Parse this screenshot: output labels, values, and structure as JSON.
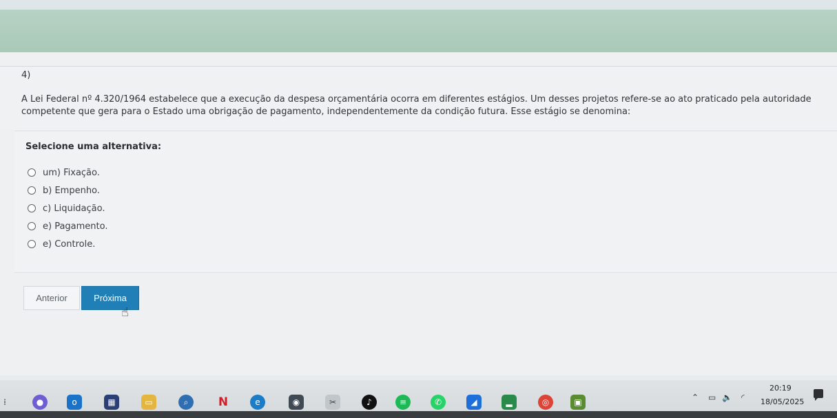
{
  "question": {
    "number": "4)",
    "text": "A Lei Federal nº 4.320/1964 estabelece que a execução da despesa orçamentária ocorra em diferentes estágios. Um desses projetos refere-se ao ato praticado pela autoridade competente que gera para o Estado uma obrigação de pagamento, independentemente da condição futura. Esse estágio se denomina:"
  },
  "select_label": "Selecione uma alternativa:",
  "options": [
    {
      "label": "um) Fixação."
    },
    {
      "label": "b) Empenho."
    },
    {
      "label": "c) Liquidação."
    },
    {
      "label": "e) Pagamento."
    },
    {
      "label": "e) Controle."
    }
  ],
  "buttons": {
    "previous": "Anterior",
    "next": "Próxima"
  },
  "taskbar": {
    "time": "20:19",
    "date": "18/05/2025",
    "icons": [
      "widgets-icon",
      "media-player-icon",
      "outlook-icon",
      "calculator-icon",
      "file-explorer-icon",
      "search-app-icon",
      "netflix-icon",
      "edge-icon",
      "camera-icon",
      "snipping-tool-icon",
      "tiktok-icon",
      "spotify-icon",
      "whatsapp-icon",
      "photos-icon",
      "gallery-icon",
      "chrome-icon",
      "minecraft-icon"
    ],
    "tray_icons": [
      "chevron-up-icon",
      "battery-icon",
      "speaker-icon",
      "wifi-icon",
      "notification-icon"
    ]
  },
  "colors": {
    "accent": "#1f7fb6",
    "band": "#a9c9b8"
  }
}
